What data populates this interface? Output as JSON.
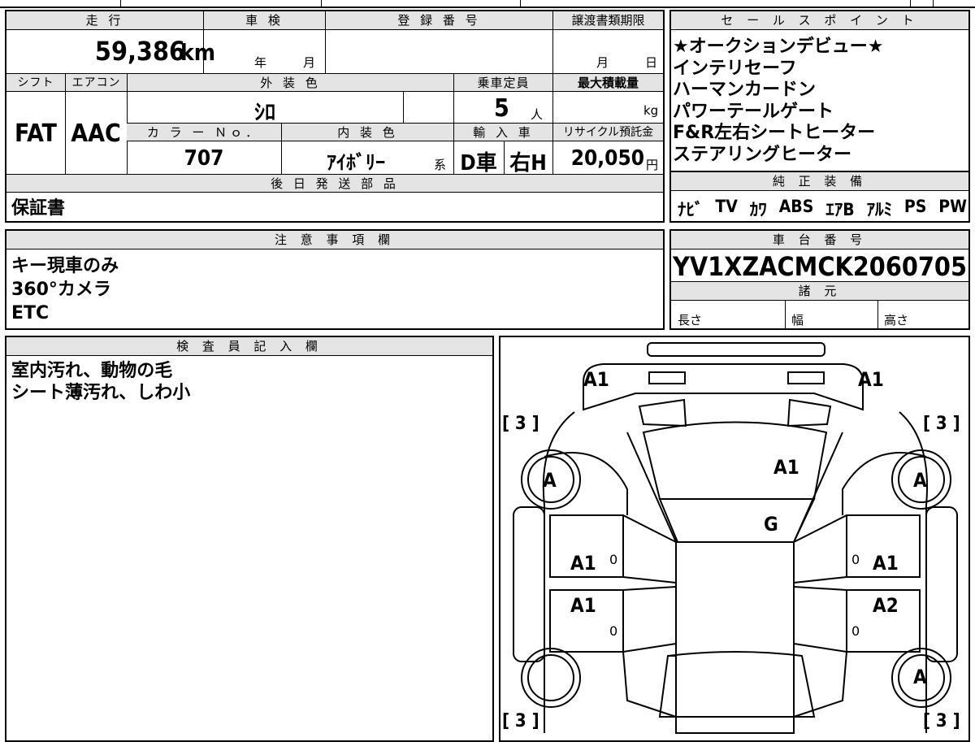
{
  "main_sheet": {
    "mileage_label": "走 行",
    "mileage_value": "59,386",
    "mileage_unit": "km",
    "inspection_label": "車 検",
    "inspection_year": "年",
    "inspection_month": "月",
    "reg_label": "登 録 番 号",
    "transfer_label": "譲渡書類期限",
    "transfer_month": "月",
    "transfer_day": "日",
    "shift_label": "シフト",
    "shift_value": "FAT",
    "ac_label": "エアコン",
    "ac_value": "AAC",
    "ext_color_label": "外 装 色",
    "ext_color_value": "ｼﾛ",
    "capacity_label": "乗車定員",
    "capacity_value": "5",
    "capacity_unit": "人",
    "max_load_label": "最大積載量",
    "max_load_unit": "kg",
    "color_no_label": "カ ラ ー Ｎｏ．",
    "color_no_value": "707",
    "int_color_label": "内 装 色",
    "int_color_value": "ｱｲﾎﾞﾘｰ",
    "int_color_suffix": "系",
    "import_label": "輸 入 車",
    "import_value": "D車",
    "handle_value": "右H",
    "recycle_label": "リサイクル預託金",
    "recycle_value": "20,050",
    "recycle_unit": "円",
    "parts_label": "後 日 発 送 部 品",
    "parts_value": "保証書"
  },
  "sales_points": {
    "label": "セ ー ル ス ポ イ ン ト",
    "items": [
      "★オークションデビュー★",
      "インテリセーフ",
      "ハーマンカードン",
      "パワーテールゲート",
      "F&R左右シートヒーター",
      "ステアリングヒーター"
    ]
  },
  "equipment": {
    "label": "純 正 装 備",
    "items": [
      "ﾅﾋﾞ",
      "TV",
      "ｶﾜ",
      "ABS",
      "ｴｱB",
      "ｱﾙﾐ",
      "PS",
      "PW"
    ]
  },
  "notes": {
    "label": "注 意 事 項 欄",
    "lines": [
      "キー現車のみ",
      "360°カメラ",
      "ETC"
    ]
  },
  "chassis": {
    "label": "車 台 番 号",
    "value": "YV1XZACMCK2060705",
    "specs_label": "諸 元",
    "length_label": "長さ",
    "width_label": "幅",
    "height_label": "高さ"
  },
  "inspector": {
    "label": "検 査 員 記 入 欄",
    "lines": [
      "室内汚れ、動物の毛",
      "シート薄汚れ、しわ小"
    ]
  },
  "diagram": {
    "tire_fl": "[ 3 ]",
    "tire_fr": "[ 3 ]",
    "tire_rl": "[ 3 ]",
    "tire_rr": "[ 3 ]",
    "bumper_left": "A1",
    "bumper_right": "A1",
    "hood": "A1",
    "windshield": "G",
    "wheel_fl": "A",
    "wheel_fr": "A",
    "wheel_rr": "A",
    "door_fl": "A1",
    "door_fr": "A1",
    "door_rl": "A1",
    "door_rr": "A2",
    "door_fl_num": "0",
    "door_fr_num": "0",
    "door_rl_num": "0",
    "door_rr_num": "0"
  }
}
